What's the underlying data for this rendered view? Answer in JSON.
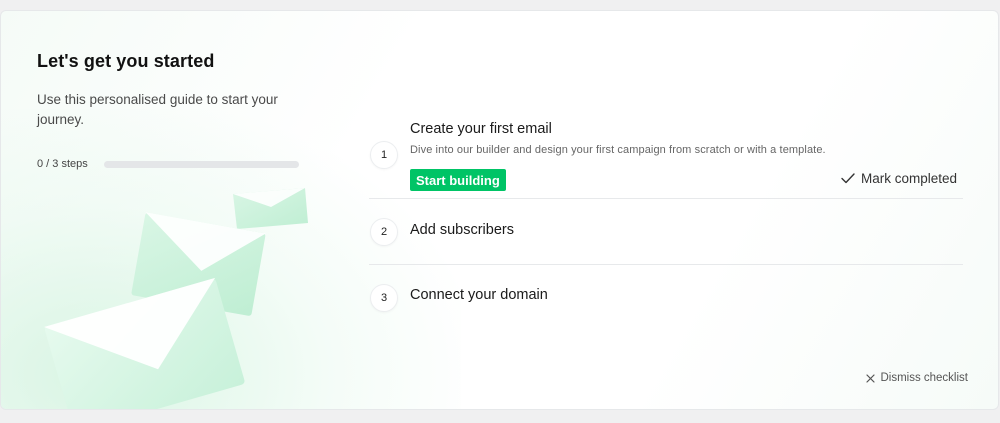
{
  "checklist": {
    "title": "Let's get you started",
    "subtitle": "Use this personalised guide to start your journey.",
    "progress": {
      "text": "0 / 3 steps",
      "completed": 0,
      "total": 3,
      "fraction": 0
    },
    "steps": [
      {
        "number": "1",
        "title": "Create your first email",
        "description": "Dive into our builder and design your first campaign from scratch or with a template.",
        "action_label": "Start building",
        "mark_label": "Mark completed"
      },
      {
        "number": "2",
        "title": "Add subscribers"
      },
      {
        "number": "3",
        "title": "Connect your domain"
      }
    ],
    "dismiss_label": "Dismiss checklist",
    "illustration_icon": "envelope-icon"
  },
  "colors": {
    "accent": "#00c466",
    "progress_track": "#e4e6e8",
    "envelope_tint": "#c9f2da"
  }
}
